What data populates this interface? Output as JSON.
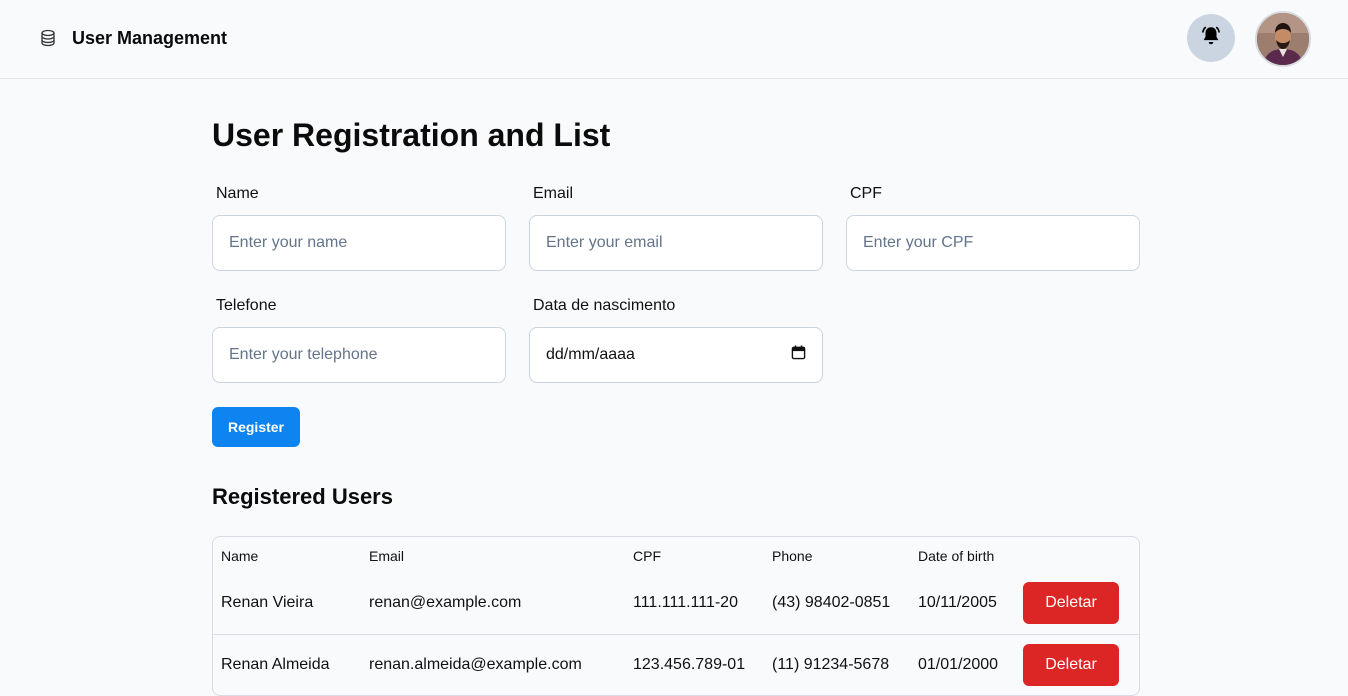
{
  "header": {
    "app_title": "User Management",
    "brand_icon": "database-icon",
    "notification_icon": "bell-icon",
    "avatar_alt": "user-avatar"
  },
  "page_title": "User Registration and List",
  "form": {
    "fields": [
      {
        "label": "Name",
        "placeholder": "Enter your name"
      },
      {
        "label": "Email",
        "placeholder": "Enter your email"
      },
      {
        "label": "CPF",
        "placeholder": "Enter your CPF"
      },
      {
        "label": "Telefone",
        "placeholder": "Enter your telephone"
      },
      {
        "label": "Data de nascimento",
        "value": "dd/mm/aaaa"
      }
    ],
    "register_label": "Register"
  },
  "users_section": {
    "title": "Registered Users",
    "columns": [
      "Name",
      "Email",
      "CPF",
      "Phone",
      "Date of birth"
    ],
    "rows": [
      {
        "name": "Renan Vieira",
        "email": "renan@example.com",
        "cpf": "111.111.111-20",
        "phone": "(43) 98402-0851",
        "birth": "10/11/2005",
        "action": "Deletar"
      },
      {
        "name": "Renan Almeida",
        "email": "renan.almeida@example.com",
        "cpf": "123.456.789-01",
        "phone": "(11) 91234-5678",
        "birth": "01/01/2000",
        "action": "Deletar"
      }
    ]
  },
  "colors": {
    "primary": "#0d84f0",
    "danger": "#dc2626",
    "background": "#f8fafc",
    "bell_bg": "#cbd5e1"
  }
}
